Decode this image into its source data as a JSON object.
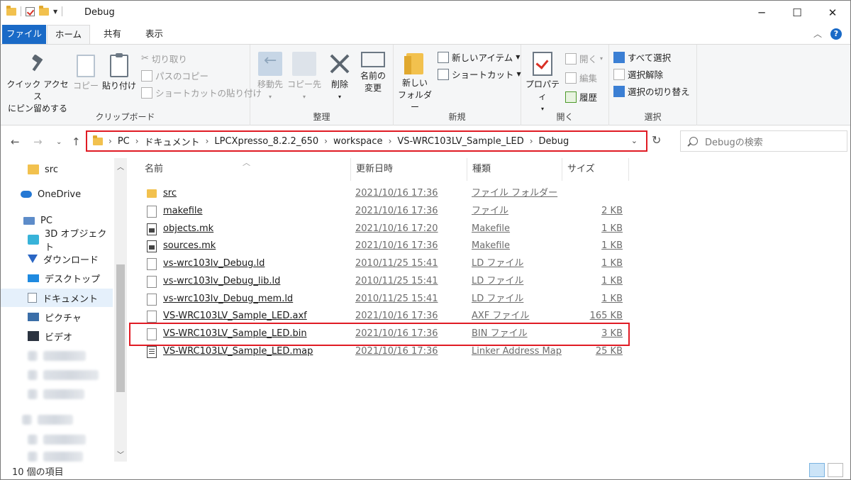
{
  "window": {
    "title": "Debug",
    "controls": [
      "─",
      "☐",
      "✕"
    ]
  },
  "ribbon": {
    "tabs": {
      "file": "ファイル",
      "home": "ホーム",
      "share": "共有",
      "view": "表示"
    },
    "clipboard": {
      "label": "クリップボード",
      "pin_line1": "クイック アクセス",
      "pin_line2": "にピン留めする",
      "copy": "コピー",
      "paste": "貼り付け",
      "cut": "切り取り",
      "copy_path": "パスのコピー",
      "paste_shortcut": "ショートカットの貼り付け"
    },
    "organize": {
      "label": "整理",
      "move_to": "移動先",
      "copy_to": "コピー先",
      "delete": "削除",
      "rename_line1": "名前の",
      "rename_line2": "変更"
    },
    "new": {
      "label": "新規",
      "new_folder_line1": "新しい",
      "new_folder_line2": "フォルダー",
      "new_item": "新しいアイテム",
      "shortcut": "ショートカット"
    },
    "open": {
      "label": "開く",
      "properties": "プロパティ",
      "open": "開く",
      "edit": "編集",
      "history": "履歴"
    },
    "select": {
      "label": "選択",
      "select_all": "すべて選択",
      "select_none": "選択解除",
      "invert": "選択の切り替え"
    }
  },
  "address": {
    "crumbs": [
      "PC",
      "ドキュメント",
      "LPCXpresso_8.2.2_650",
      "workspace",
      "VS-WRC103LV_Sample_LED",
      "Debug"
    ],
    "search_placeholder": "Debugの検索"
  },
  "navpane": {
    "items": [
      {
        "label": "src",
        "icon": "folder-icon"
      },
      {
        "label": "OneDrive",
        "icon": "cloud-icon"
      },
      {
        "label": "PC",
        "icon": "pc-icon"
      },
      {
        "label": "3D オブジェクト",
        "icon": "3d-objects-icon"
      },
      {
        "label": "ダウンロード",
        "icon": "download-icon"
      },
      {
        "label": "デスクトップ",
        "icon": "desktop-icon"
      },
      {
        "label": "ドキュメント",
        "icon": "documents-icon"
      },
      {
        "label": "ピクチャ",
        "icon": "pictures-icon"
      },
      {
        "label": "ビデオ",
        "icon": "videos-icon"
      }
    ]
  },
  "filelist": {
    "columns": {
      "name": "名前",
      "date": "更新日時",
      "type": "種類",
      "size": "サイズ"
    },
    "files": [
      {
        "name": "src",
        "date": "2021/10/16 17:36",
        "type": "ファイル フォルダー",
        "size": "",
        "icon": "folder-icon"
      },
      {
        "name": "makefile",
        "date": "2021/10/16 17:36",
        "type": "ファイル",
        "size": "2 KB",
        "icon": "file-icon"
      },
      {
        "name": "objects.mk",
        "date": "2021/10/16 17:20",
        "type": "Makefile",
        "size": "1 KB",
        "icon": "makefile-icon"
      },
      {
        "name": "sources.mk",
        "date": "2021/10/16 17:36",
        "type": "Makefile",
        "size": "1 KB",
        "icon": "makefile-icon"
      },
      {
        "name": "vs-wrc103lv_Debug.ld",
        "date": "2010/11/25 15:41",
        "type": "LD ファイル",
        "size": "1 KB",
        "icon": "file-icon"
      },
      {
        "name": "vs-wrc103lv_Debug_lib.ld",
        "date": "2010/11/25 15:41",
        "type": "LD ファイル",
        "size": "1 KB",
        "icon": "file-icon"
      },
      {
        "name": "vs-wrc103lv_Debug_mem.ld",
        "date": "2010/11/25 15:41",
        "type": "LD ファイル",
        "size": "1 KB",
        "icon": "file-icon"
      },
      {
        "name": "VS-WRC103LV_Sample_LED.axf",
        "date": "2021/10/16 17:36",
        "type": "AXF ファイル",
        "size": "165 KB",
        "icon": "file-icon"
      },
      {
        "name": "VS-WRC103LV_Sample_LED.bin",
        "date": "2021/10/16 17:36",
        "type": "BIN ファイル",
        "size": "3 KB",
        "icon": "file-icon"
      },
      {
        "name": "VS-WRC103LV_Sample_LED.map",
        "date": "2021/10/16 17:36",
        "type": "Linker Address Map",
        "size": "25 KB",
        "icon": "map-icon"
      }
    ]
  },
  "status": {
    "count": "10 個の項目"
  },
  "colors": {
    "accent": "#1a6ac7",
    "highlight": "#e01b24",
    "selected": "#e5f0fb"
  }
}
